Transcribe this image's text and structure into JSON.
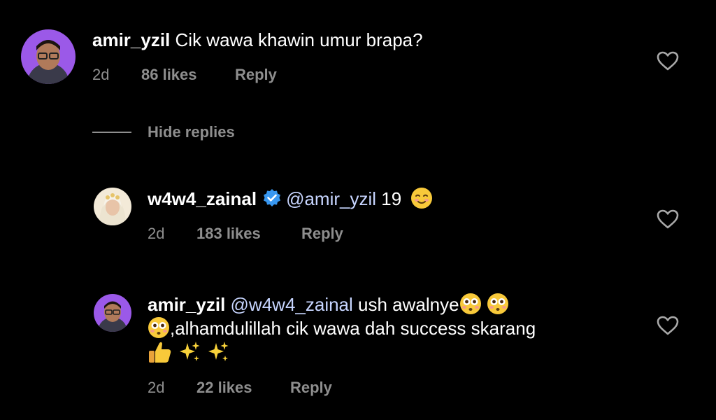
{
  "comments": [
    {
      "username": "amir_yzil",
      "text": "Cik wawa khawin umur brapa?",
      "time": "2d",
      "likes": "86 likes",
      "reply_label": "Reply"
    }
  ],
  "hide_replies_label": "Hide replies",
  "replies": [
    {
      "username": "w4w4_zainal",
      "verified": true,
      "mention": "@amir_yzil",
      "text": "19",
      "emoji": "smiling-face-icon",
      "time": "2d",
      "likes": "183 likes",
      "reply_label": "Reply"
    },
    {
      "username": "amir_yzil",
      "mention": "@w4w4_zainal",
      "text_part1": "ush awalnye",
      "text_part2": ",alhamdulillah cik wawa dah success skarang",
      "emojis": [
        "flushed-face-icon",
        "flushed-face-icon",
        "flushed-face-icon",
        "thumbs-up-icon",
        "sparkles-icon",
        "sparkles-icon"
      ],
      "time": "2d",
      "likes": "22 likes",
      "reply_label": "Reply"
    }
  ],
  "colors": {
    "background": "#000000",
    "text": "#ffffff",
    "muted": "#8e8e8e",
    "mention": "#c7d5ff",
    "verified": "#3897f0"
  }
}
